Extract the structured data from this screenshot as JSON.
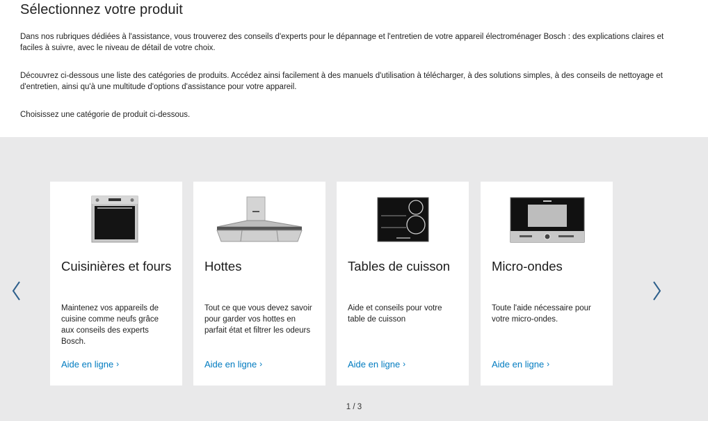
{
  "intro": {
    "title": "Sélectionnez votre produit",
    "paragraph_1": "Dans nos rubriques dédiées à l'assistance, vous trouverez des conseils d'experts pour le dépannage et l'entretien de votre appareil électroménager Bosch : des explications claires et faciles à suivre, avec le niveau de détail de votre choix.",
    "paragraph_2": "Découvrez ci-dessous une liste des catégories de produits. Accédez ainsi facilement à des manuels d'utilisation à télécharger, à des solutions simples, à des conseils de nettoyage et d'entretien, ainsi qu'à une multitude d'options d'assistance pour votre appareil.",
    "paragraph_3": "Choisissez une catégorie de produit ci-dessous."
  },
  "carousel": {
    "prev_icon": "chevron-left-icon",
    "next_icon": "chevron-right-icon",
    "pagination": "1 / 3",
    "cards": [
      {
        "title": "Cuisinières et fours",
        "description": "Maintenez vos appareils de cuisine comme neufs grâce aux conseils des experts Bosch.",
        "link": "Aide en ligne"
      },
      {
        "title": "Hottes",
        "description": "Tout ce que vous devez savoir pour garder vos hottes en parfait état et filtrer les odeurs",
        "link": "Aide en ligne"
      },
      {
        "title": "Tables de cuisson",
        "description": "Aide et conseils pour votre table de cuisson",
        "link": "Aide en ligne"
      },
      {
        "title": "Micro-ondes",
        "description": "Toute l'aide nécessaire pour votre micro-ondes.",
        "link": "Aide en ligne"
      }
    ]
  },
  "colors": {
    "link": "#007bc0",
    "carousel_bg": "#e9e9ea",
    "card_bg": "#ffffff",
    "arrow": "#2d5f8b"
  }
}
